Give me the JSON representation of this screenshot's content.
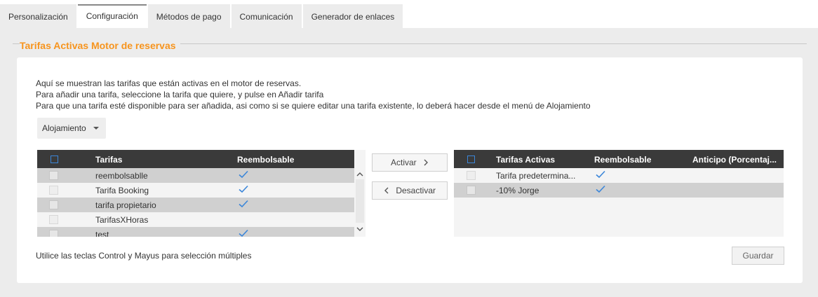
{
  "tabs": [
    {
      "label": "Personalización",
      "active": false
    },
    {
      "label": "Configuración",
      "active": true
    },
    {
      "label": "Métodos de pago",
      "active": false
    },
    {
      "label": "Comunicación",
      "active": false
    },
    {
      "label": "Generador de enlaces",
      "active": false
    }
  ],
  "section": {
    "title": "Tarifas Activas Motor de reservas"
  },
  "description": [
    "Aquí se muestran las tarifas que están activas en el motor de reservas.",
    "Para añadir una tarifa, seleccione la tarifa que quiere, y pulse en Añadir tarifa",
    "Para que una tarifa esté disponible para ser añadida, asi como si se quiere editar una tarifa existente, lo deberá hacer desde el menú de Alojamiento"
  ],
  "filter": {
    "selected": "Alojamiento"
  },
  "available_grid": {
    "columns": [
      "Tarifas",
      "Reembolsable"
    ],
    "rows": [
      {
        "name": "reembolsablle",
        "refundable": true
      },
      {
        "name": "Tarifa Booking",
        "refundable": true
      },
      {
        "name": "tarifa propietario",
        "refundable": true
      },
      {
        "name": "TarifasXHoras",
        "refundable": false
      },
      {
        "name": "test",
        "refundable": true
      }
    ]
  },
  "actions": {
    "activate_label": "Activar",
    "deactivate_label": "Desactivar",
    "save_label": "Guardar"
  },
  "active_grid": {
    "columns": [
      "Tarifas Activas",
      "Reembolsable",
      "Anticipo (Porcentaj..."
    ],
    "rows": [
      {
        "name": "Tarifa predetermina...",
        "refundable": true
      },
      {
        "name": "-10% Jorge",
        "refundable": true
      }
    ]
  },
  "footer": {
    "hint": "Utilice las teclas Control y Mayus para selección múltiples"
  },
  "colors": {
    "accent_orange": "#f7941d",
    "check_blue": "#3b86d9",
    "header_dark": "#3a3a3a"
  }
}
